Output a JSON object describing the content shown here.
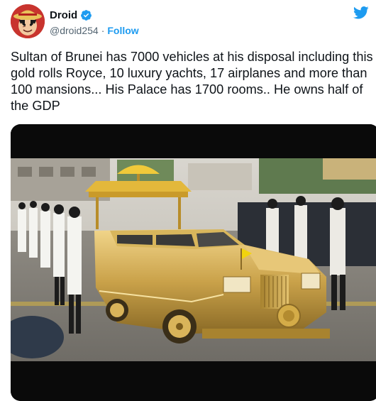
{
  "tweet": {
    "author": {
      "display_name": "Droid",
      "handle": "@droid254",
      "verified": true,
      "avatar_icon": "straw-hat-avatar-icon"
    },
    "separator": "·",
    "follow_label": "Follow",
    "brand_icon": "twitter-bird-icon",
    "text": "Sultan of Brunei has 7000 vehicles at his disposal including this gold rolls Royce, 10 luxury yachts, 17 airplanes and more than 100 mansions... His Palace has 1700 rooms.. He owns half of the GDP",
    "media": {
      "icon": "gold-rolls-royce-photo"
    }
  },
  "colors": {
    "accent": "#1d9bf0",
    "text": "#0f1419",
    "muted": "#536471",
    "gold": "#c9a244"
  }
}
